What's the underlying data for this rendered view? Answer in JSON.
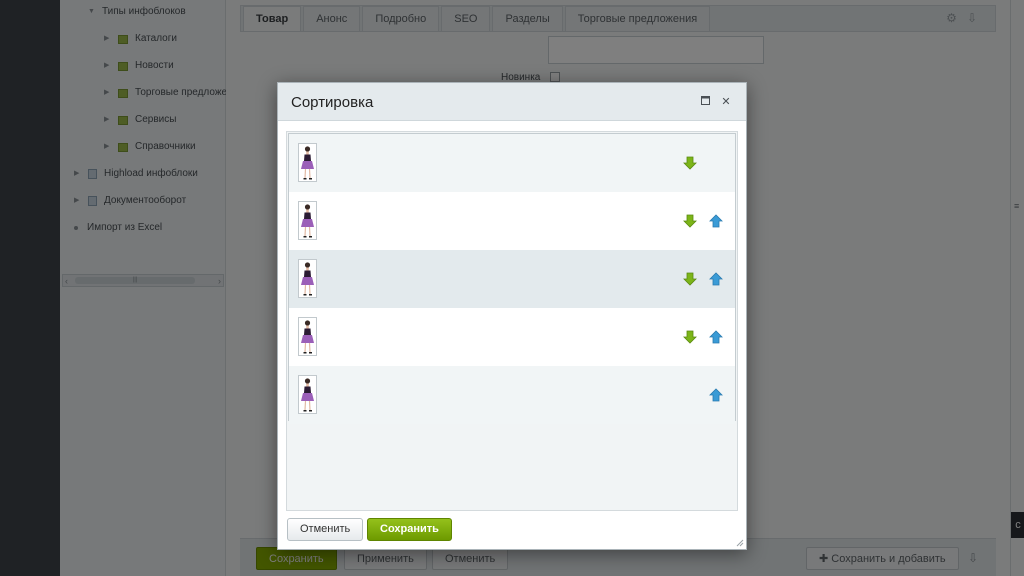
{
  "sidebar": {
    "items": [
      {
        "label": "Типы инфоблоков"
      },
      {
        "label": "Каталоги"
      },
      {
        "label": "Новости"
      },
      {
        "label": "Торговые предложе"
      },
      {
        "label": "Сервисы"
      },
      {
        "label": "Справочники"
      },
      {
        "label": "Highload инфоблоки"
      },
      {
        "label": "Документооборот"
      },
      {
        "label": "Импорт из Excel"
      }
    ]
  },
  "editor": {
    "tabs": [
      {
        "label": "Товар",
        "active": true
      },
      {
        "label": "Анонс"
      },
      {
        "label": "Подробно"
      },
      {
        "label": "SEO"
      },
      {
        "label": "Разделы"
      },
      {
        "label": "Торговые предложения"
      }
    ],
    "tools": {
      "settings_icon": "gear-icon",
      "pin_icon": "pin-icon"
    },
    "field_label": "Новинка",
    "bottom_buttons": {
      "save": "Сохранить",
      "apply": "Применить",
      "cancel": "Отменить",
      "save_and_add": "Сохранить и добавить"
    }
  },
  "dialog": {
    "title": "Сортировка",
    "maximize_icon": "maximize-icon",
    "close_icon": "close-icon",
    "rows": [
      {
        "thumbnail": "product-photo",
        "can_move_down": true,
        "can_move_up": false,
        "background": "#f1f5f6"
      },
      {
        "thumbnail": "product-photo",
        "can_move_down": true,
        "can_move_up": true,
        "background": "#ffffff"
      },
      {
        "thumbnail": "product-photo",
        "can_move_down": true,
        "can_move_up": true,
        "background": "#e3eaed"
      },
      {
        "thumbnail": "product-photo",
        "can_move_down": true,
        "can_move_up": true,
        "background": "#ffffff"
      },
      {
        "thumbnail": "product-photo",
        "can_move_down": false,
        "can_move_up": true,
        "background": "#f1f5f6"
      }
    ],
    "buttons": {
      "cancel": "Отменить",
      "save": "Сохранить"
    }
  },
  "colors": {
    "accent_green": "#86ad00",
    "arrow_down": "#7cb518",
    "arrow_up": "#3a9bd6"
  }
}
